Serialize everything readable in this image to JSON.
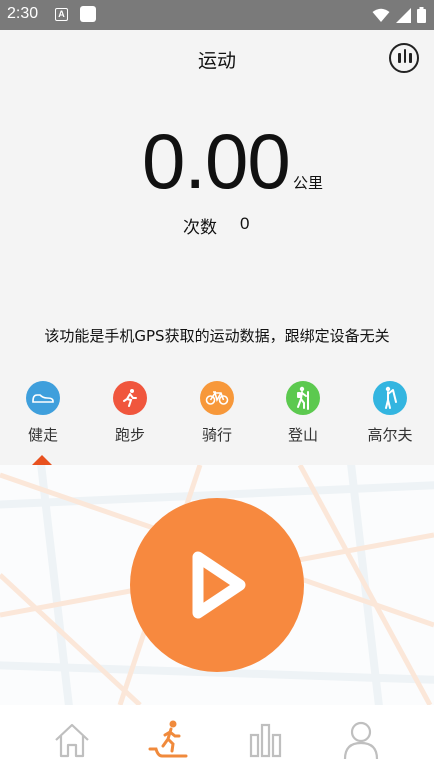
{
  "status_bar": {
    "time": "2:30",
    "notification_glyph": "A"
  },
  "header": {
    "title": "运动",
    "stats_icon": "stats-bars-icon"
  },
  "distance": {
    "value": "0.00",
    "unit": "公里"
  },
  "count": {
    "label": "次数",
    "value": "0"
  },
  "notice": "该功能是手机GPS获取的运动数据，跟绑定设备无关",
  "sport_tabs": [
    {
      "label": "健走",
      "icon": "shoe-icon",
      "color": "#3f9fdc",
      "selected": true
    },
    {
      "label": "跑步",
      "icon": "running-icon",
      "color": "#f0563d",
      "selected": false
    },
    {
      "label": "骑行",
      "icon": "bicycle-icon",
      "color": "#f7983a",
      "selected": false
    },
    {
      "label": "登山",
      "icon": "hiking-icon",
      "color": "#5cc94f",
      "selected": false
    },
    {
      "label": "高尔夫",
      "icon": "golf-icon",
      "color": "#33b5e0",
      "selected": false
    }
  ],
  "colors": {
    "accent": "#f7893f",
    "indicator": "#e8511f",
    "background": "#f4f4f4"
  },
  "start_button": {
    "icon": "play-icon"
  },
  "bottom_nav": [
    {
      "name": "home",
      "icon": "home-icon",
      "active": false
    },
    {
      "name": "sport",
      "icon": "walking-treadmill-icon",
      "active": true
    },
    {
      "name": "data",
      "icon": "bar-chart-icon",
      "active": false
    },
    {
      "name": "profile",
      "icon": "person-icon",
      "active": false
    }
  ]
}
